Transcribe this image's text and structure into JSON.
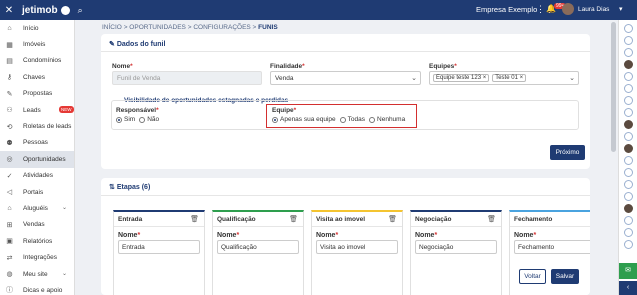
{
  "topbar": {
    "close_icon": "close-icon",
    "logo_text": "jetimob",
    "company": "Empresa Exemplo",
    "notifications_count": "99+",
    "user_name": "Laura Dias"
  },
  "sidebar": {
    "items": [
      {
        "label": "Início",
        "icon": "home-icon"
      },
      {
        "label": "Imóveis",
        "icon": "building-icon"
      },
      {
        "label": "Condomínios",
        "icon": "condo-icon"
      },
      {
        "label": "Chaves",
        "icon": "key-icon"
      },
      {
        "label": "Propostas",
        "icon": "proposal-icon"
      },
      {
        "label": "Leads",
        "icon": "leads-icon",
        "badge": "NEW"
      },
      {
        "label": "Roletas de leads",
        "icon": "roulette-icon"
      },
      {
        "label": "Pessoas",
        "icon": "people-icon"
      },
      {
        "label": "Oportunidades",
        "icon": "opportunity-icon",
        "active": true
      },
      {
        "label": "Atividades",
        "icon": "activity-icon"
      },
      {
        "label": "Portais",
        "icon": "portal-icon"
      },
      {
        "label": "Aluguéis",
        "icon": "rent-icon",
        "expandable": true
      },
      {
        "label": "Vendas",
        "icon": "sales-icon"
      },
      {
        "label": "Relatórios",
        "icon": "report-icon"
      },
      {
        "label": "Integrações",
        "icon": "integration-icon"
      },
      {
        "label": "Meu site",
        "icon": "site-icon",
        "expandable": true
      },
      {
        "label": "Dicas e apoio",
        "icon": "help-icon"
      }
    ]
  },
  "breadcrumb": {
    "items": [
      "INÍCIO",
      "OPORTUNIDADES",
      "CONFIGURAÇÕES"
    ],
    "separator": ">",
    "current": "FUNIS"
  },
  "funnel": {
    "title": "Dados do funil",
    "nome_label": "Nome",
    "nome_placeholder": "Funil de Venda",
    "finalidade_label": "Finalidade",
    "finalidade_value": "Venda",
    "equipes_label": "Equipes",
    "equipes_chips": [
      "Equipe teste 123 ×",
      "Teste 01 ×"
    ],
    "visibility_title": "Visibilidade de oportunidades estagnadas e perdidas",
    "responsavel_label": "Responsável",
    "responsavel_options": [
      "Sim",
      "Não"
    ],
    "responsavel_selected": "Sim",
    "equipe_label": "Equipe",
    "equipe_options": [
      "Apenas sua equipe",
      "Todas",
      "Nenhuma"
    ],
    "equipe_selected": "Apenas sua equipe",
    "next_button": "Próximo"
  },
  "stages": {
    "title": "Etapas (6)",
    "field_label": "Nome",
    "items": [
      {
        "name": "Entrada",
        "color": "#1f3b73"
      },
      {
        "name": "Qualificação",
        "color": "#2e9e4e"
      },
      {
        "name": "Visita ao imovel",
        "color": "#f4c430"
      },
      {
        "name": "Negociação",
        "color": "#1f3b73"
      },
      {
        "name": "Fechamento",
        "color": "#4aa3df"
      }
    ],
    "back_button": "Voltar",
    "save_button": "Salvar"
  },
  "colors": {
    "primary": "#1f3b73",
    "required": "#d32f2f",
    "highlight": "#d32f2f"
  }
}
